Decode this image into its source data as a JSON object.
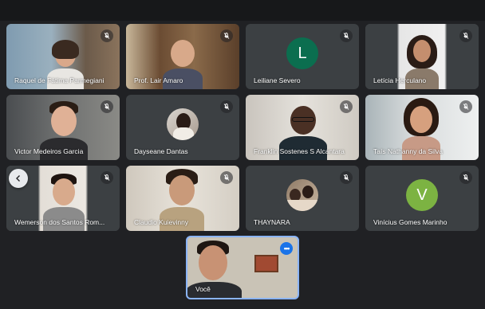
{
  "participants": [
    {
      "name": "Raquel de Fátima Parmegiani",
      "muted": true
    },
    {
      "name": "Prof. Lair Amaro",
      "muted": true
    },
    {
      "name": "Leiliane Severo",
      "muted": true,
      "avatar_letter": "L",
      "avatar_color": "#0b6e4f"
    },
    {
      "name": "Letícia Herculano",
      "muted": true
    },
    {
      "name": "Victor Medeiros Garcia",
      "muted": true
    },
    {
      "name": "Dayseane Dantas",
      "muted": true
    },
    {
      "name": "Franklin Sostenes S Alcantara",
      "muted": true
    },
    {
      "name": "Taís Nathanny da Silva",
      "muted": true
    },
    {
      "name": "Wemerson dos Santos Rom...",
      "muted": true
    },
    {
      "name": "Claudio Kuievinny",
      "muted": true
    },
    {
      "name": "THAYNARA",
      "muted": true
    },
    {
      "name": "Vinícius Gomes Marinho",
      "muted": true,
      "avatar_letter": "V",
      "avatar_color": "#7cb342"
    }
  ],
  "self": {
    "name": "Você"
  },
  "icons": {
    "mic_off": "mic-off-icon",
    "prev": "chevron-left-icon",
    "more": "more-options-icon"
  },
  "colors": {
    "background": "#202124",
    "self_border": "#8ab4f8",
    "more_button": "#1a73e8"
  }
}
